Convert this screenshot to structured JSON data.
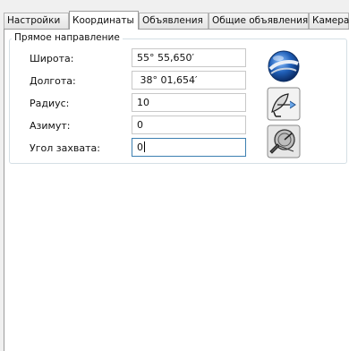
{
  "tabs": [
    {
      "label": "Настройки"
    },
    {
      "label": "Координаты"
    },
    {
      "label": "Объявления"
    },
    {
      "label": "Общие объявления"
    },
    {
      "label": "Камера"
    }
  ],
  "group": {
    "title": "Прямое направление",
    "fields": [
      {
        "label": "Широта:",
        "value": "55° 55,650′"
      },
      {
        "label": "Долгота:",
        "value": " 38° 01,654′"
      },
      {
        "label": "Радиус:",
        "value": "10"
      },
      {
        "label": "Азимут:",
        "value": "0"
      },
      {
        "label": "Угол захвата:",
        "value": "0"
      }
    ]
  },
  "buttons": {
    "globe_icon": "globe-icon",
    "satellite_dish_icon": "satellite-dish-icon",
    "radar_icon": "radar-icon"
  },
  "colors": {
    "accent_focus": "#3c7fb1",
    "globe_blue": "#1f5fb8"
  }
}
